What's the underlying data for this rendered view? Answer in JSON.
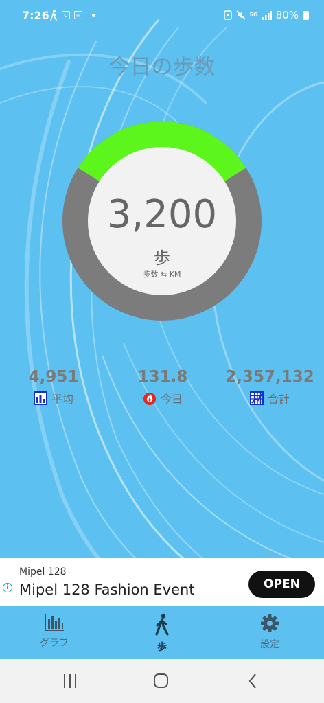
{
  "status_bar": {
    "time": "7:26",
    "left_icons": [
      "walk-icon",
      "d-app-icon",
      "news-icon"
    ],
    "network": "5G",
    "battery": "80%"
  },
  "header": {
    "title": "今日の歩数"
  },
  "steps": {
    "value": "3,200",
    "unit": "歩",
    "toggle_label": "歩数 ⇆ KM",
    "progress_fraction": 0.32,
    "colors": {
      "progress": "#5cf51c",
      "track": "#7c7c7c",
      "center": "#f2f2f2"
    }
  },
  "stats": [
    {
      "value": "4,951",
      "label": "平均",
      "icon": "average-chart-icon"
    },
    {
      "value": "131.8",
      "label": "今日",
      "icon": "flame-icon"
    },
    {
      "value": "2,357,132",
      "label": "合計",
      "icon": "total-grid-icon"
    }
  ],
  "ad": {
    "advertiser": "Mipel 128",
    "title": "Mipel 128 Fashion Event",
    "button": "OPEN"
  },
  "nav": [
    {
      "label": "グラフ",
      "icon": "bar-chart-icon"
    },
    {
      "label": "歩",
      "icon": "walk-icon",
      "active": true
    },
    {
      "label": "設定",
      "icon": "gear-icon"
    }
  ],
  "system_nav": [
    "recents-icon",
    "home-icon",
    "back-icon"
  ]
}
